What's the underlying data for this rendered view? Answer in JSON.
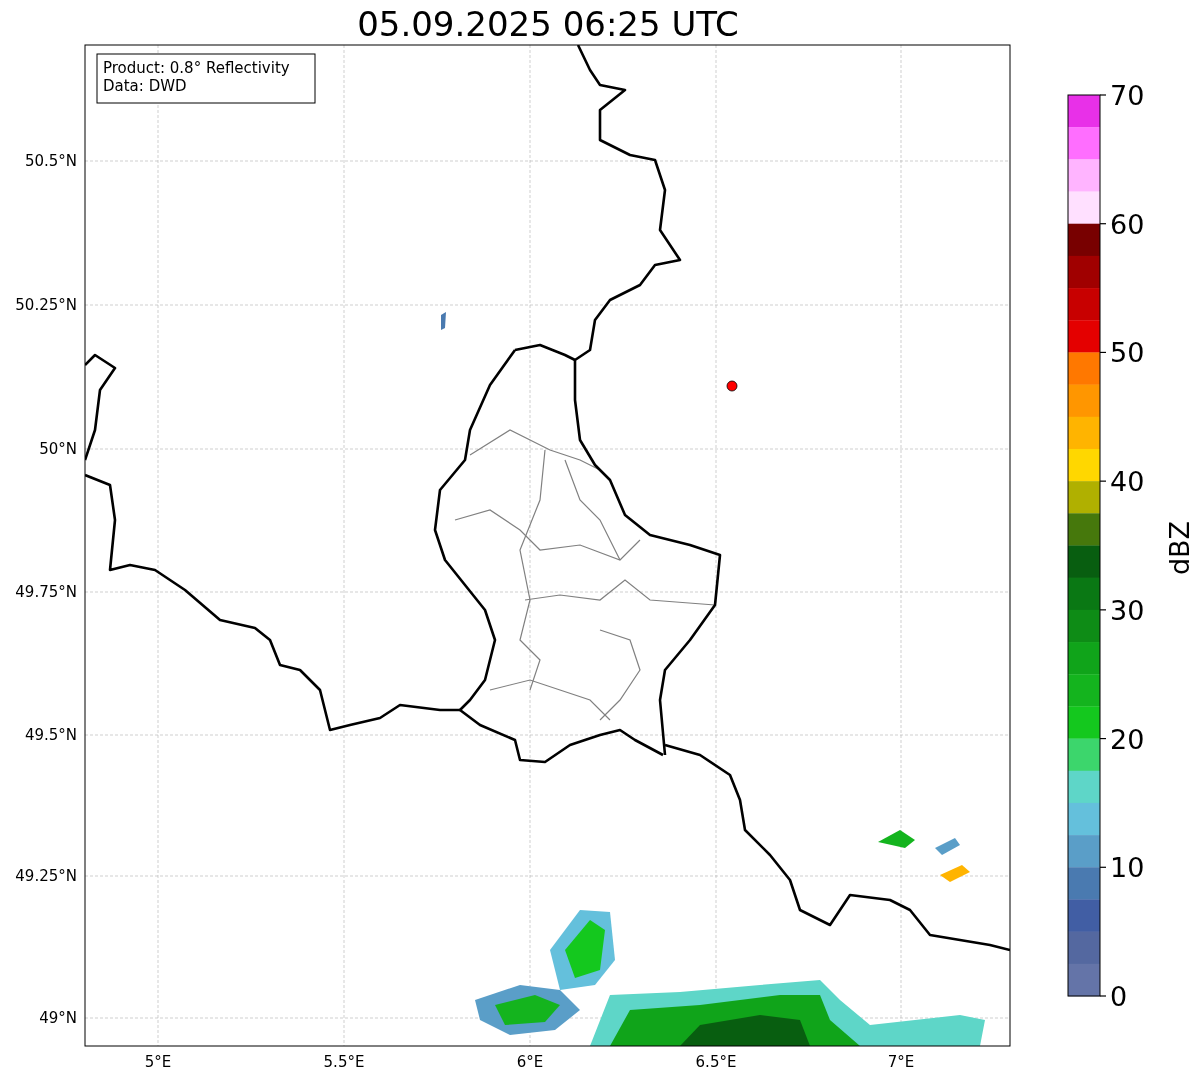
{
  "title": "05.09.2025 06:25 UTC",
  "info_box": [
    "Product: 0.8° Reflectivity",
    "Data: DWD"
  ],
  "map": {
    "lat_ticks": [
      "50.5°N",
      "50.25°N",
      "50°N",
      "49.75°N",
      "49.5°N",
      "49.25°N",
      "49°N"
    ],
    "lon_ticks": [
      "5°E",
      "5.5°E",
      "6°E",
      "6.5°E",
      "7°E"
    ]
  },
  "colorbar": {
    "label": "dBZ",
    "ticks": [
      "70",
      "60",
      "50",
      "40",
      "30",
      "20",
      "10",
      "0"
    ],
    "bins": [
      {
        "color": "#e830e8"
      },
      {
        "color": "#ff6eff"
      },
      {
        "color": "#ffb4ff"
      },
      {
        "color": "#ffe0ff"
      },
      {
        "color": "#780000"
      },
      {
        "color": "#a00000"
      },
      {
        "color": "#c80000"
      },
      {
        "color": "#e40000"
      },
      {
        "color": "#ff7800"
      },
      {
        "color": "#ff9600"
      },
      {
        "color": "#ffb400"
      },
      {
        "color": "#ffd700"
      },
      {
        "color": "#b0b000"
      },
      {
        "color": "#46780c"
      },
      {
        "color": "#085e10"
      },
      {
        "color": "#0a7814"
      },
      {
        "color": "#0e8c16"
      },
      {
        "color": "#10a41a"
      },
      {
        "color": "#14b41e"
      },
      {
        "color": "#14c81e"
      },
      {
        "color": "#3cd66c"
      },
      {
        "color": "#5ed6c8"
      },
      {
        "color": "#64c0dc"
      },
      {
        "color": "#5a9ec8"
      },
      {
        "color": "#4a7ab0"
      },
      {
        "color": "#415ea4"
      },
      {
        "color": "#5468a0"
      },
      {
        "color": "#6474a8"
      }
    ]
  }
}
